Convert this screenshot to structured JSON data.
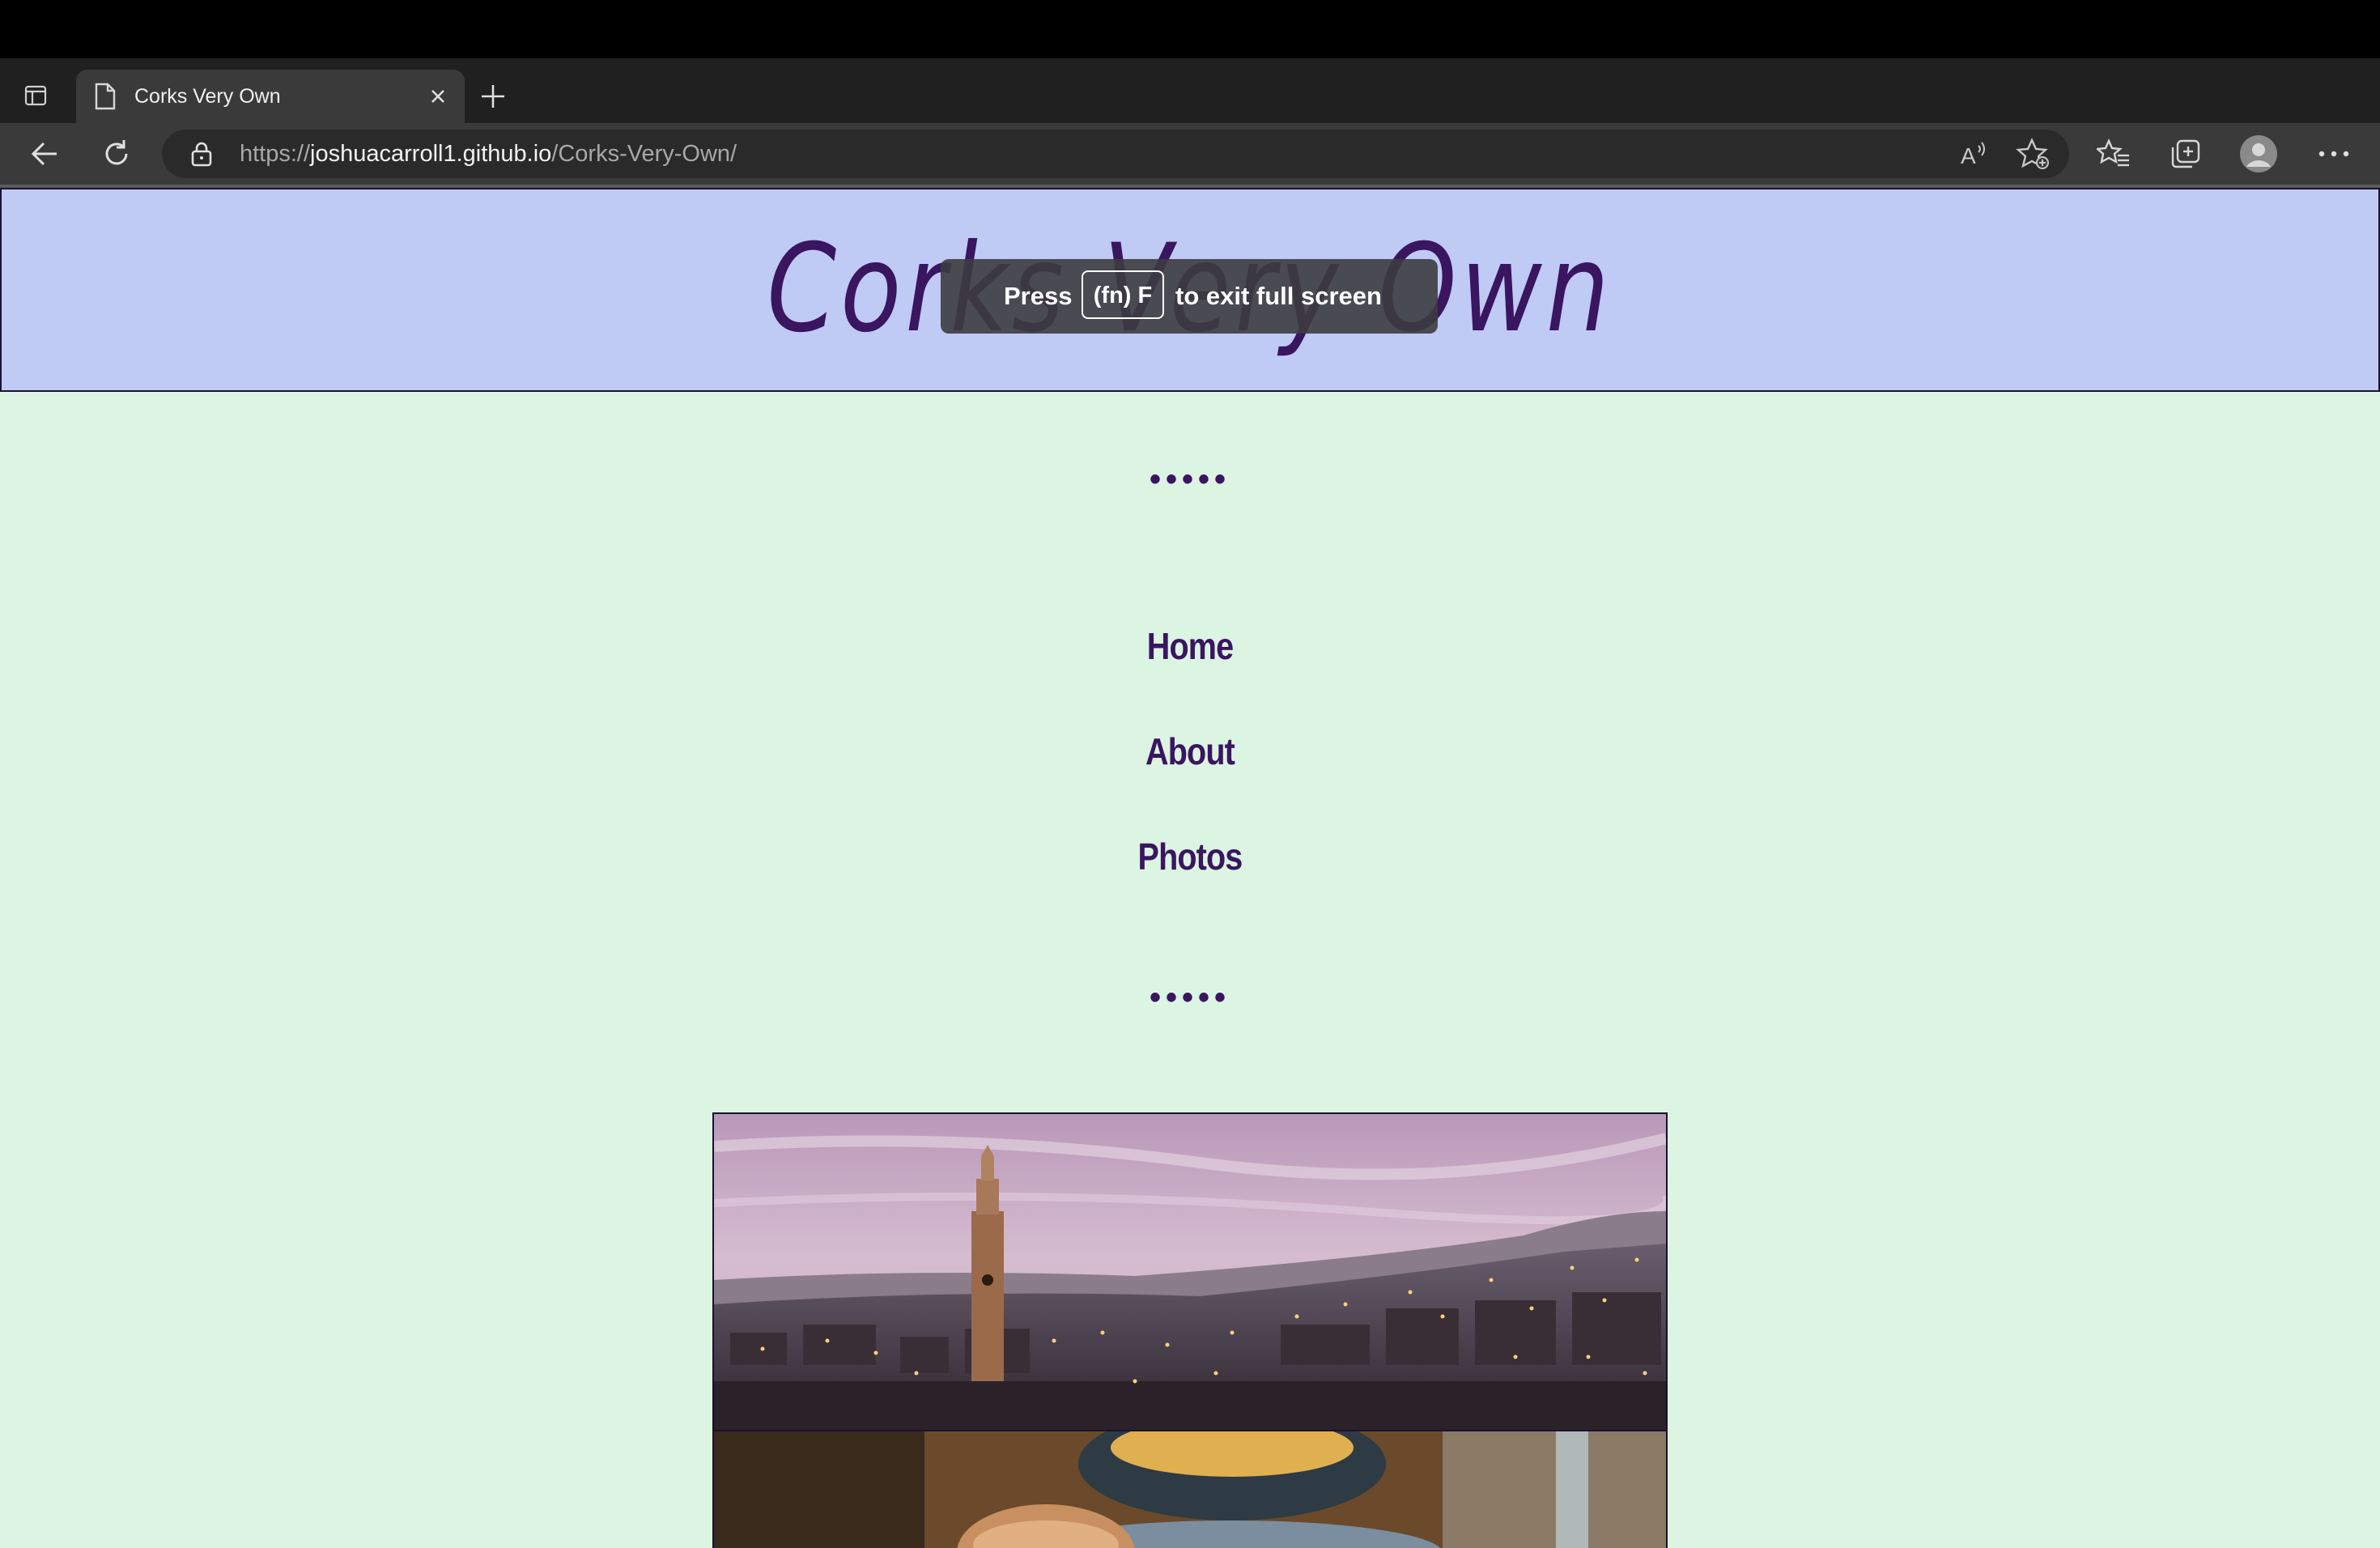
{
  "browser": {
    "tab": {
      "title": "Corks Very Own"
    },
    "address": {
      "scheme": "https://",
      "host": "joshuacarroll1.github.io",
      "path": "/Corks-Very-Own/"
    },
    "icons": {
      "sidebar": "sidebar-toggle-icon",
      "page": "page-icon",
      "close": "close-icon",
      "new_tab": "plus-icon",
      "back": "back-arrow-icon",
      "reload": "reload-icon",
      "lock": "lock-icon",
      "read_aloud": "read-aloud-icon",
      "favorite_add": "star-add-icon",
      "favorites": "favorites-icon",
      "collections": "collections-icon",
      "profile": "profile-avatar-icon",
      "more": "more-dots-icon"
    }
  },
  "fullscreen_toast": {
    "press": "Press",
    "key": "(fn) F",
    "rest": "to exit full screen"
  },
  "site": {
    "title": "Corks Very Own",
    "divider": "•••••",
    "nav": [
      "Home",
      "About",
      "Photos"
    ]
  },
  "colors": {
    "header_bg": "#bfcaf5",
    "page_bg": "#dcf4e2",
    "accent": "#3a1560"
  }
}
